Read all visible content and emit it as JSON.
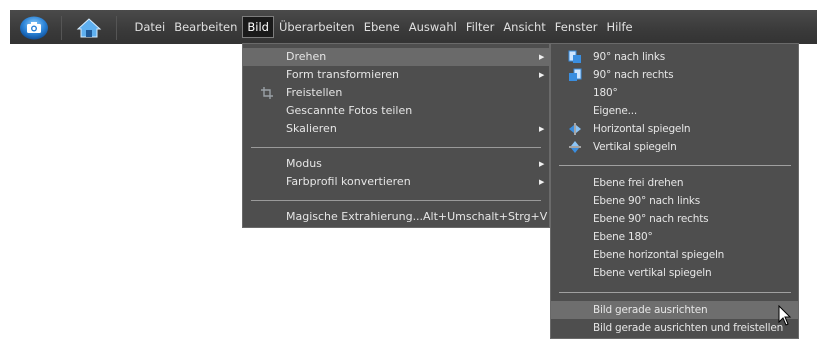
{
  "menubar": {
    "items": [
      {
        "label": "Datei"
      },
      {
        "label": "Bearbeiten"
      },
      {
        "label": "Bild"
      },
      {
        "label": "Überarbeiten"
      },
      {
        "label": "Ebene"
      },
      {
        "label": "Auswahl"
      },
      {
        "label": "Filter"
      },
      {
        "label": "Ansicht"
      },
      {
        "label": "Fenster"
      },
      {
        "label": "Hilfe"
      }
    ],
    "active_item": "Bild",
    "icons": {
      "left": "camera-organizer-icon",
      "right": "home-icon"
    }
  },
  "bild_menu": {
    "items": [
      {
        "label": "Drehen",
        "submenu": true,
        "highlighted": true
      },
      {
        "label": "Form transformieren",
        "submenu": true
      },
      {
        "label": "Freistellen",
        "icon": "crop-icon"
      },
      {
        "label": "Gescannte Fotos teilen"
      },
      {
        "label": "Skalieren",
        "submenu": true
      },
      {
        "label": "Modus",
        "submenu": true
      },
      {
        "label": "Farbprofil konvertieren",
        "submenu": true
      },
      {
        "label": "Magische Extrahierung...",
        "shortcut": "Alt+Umschalt+Strg+V"
      }
    ]
  },
  "drehen_submenu": {
    "items": [
      {
        "label": "90° nach links",
        "icon": "rotate-left-icon"
      },
      {
        "label": "90° nach rechts",
        "icon": "rotate-right-icon"
      },
      {
        "label": "180°"
      },
      {
        "label": "Eigene..."
      },
      {
        "label": "Horizontal spiegeln",
        "icon": "flip-horizontal-icon"
      },
      {
        "label": "Vertikal spiegeln",
        "icon": "flip-vertical-icon"
      },
      {
        "label": "Ebene frei drehen"
      },
      {
        "label": "Ebene 90° nach links"
      },
      {
        "label": "Ebene 90° nach rechts"
      },
      {
        "label": "Ebene 180°"
      },
      {
        "label": "Ebene horizontal spiegeln"
      },
      {
        "label": "Ebene vertikal spiegeln"
      },
      {
        "label": "Bild gerade ausrichten",
        "highlighted": true
      },
      {
        "label": "Bild gerade ausrichten und freistellen"
      }
    ]
  }
}
